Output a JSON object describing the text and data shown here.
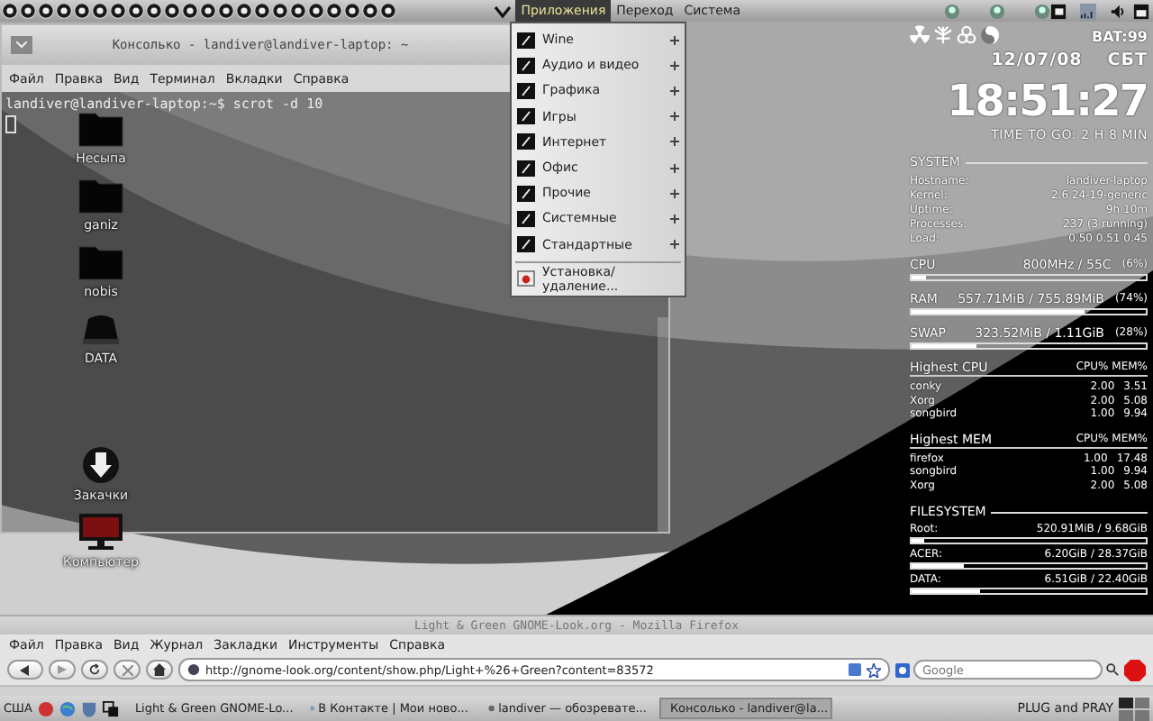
{
  "top_panel": {
    "menus": [
      {
        "label": "Приложения",
        "selected": true
      },
      {
        "label": "Переход",
        "selected": false
      },
      {
        "label": "Система",
        "selected": false
      }
    ]
  },
  "terminal": {
    "title": "Консолько - landiver@landiver-laptop: ~",
    "menu": [
      "Файл",
      "Правка",
      "Вид",
      "Терминал",
      "Вкладки",
      "Справка"
    ],
    "lines": [
      "landiver@landiver-laptop:~$ scrot -d 10"
    ]
  },
  "desktop_icons": [
    {
      "label": "Несыпа",
      "kind": "folder"
    },
    {
      "label": "ganiz",
      "kind": "folder"
    },
    {
      "label": "nobis",
      "kind": "folder"
    },
    {
      "label": "DATA",
      "kind": "drive"
    },
    {
      "label": "Закачки",
      "kind": "download"
    },
    {
      "label": "Компьютер",
      "kind": "computer"
    }
  ],
  "app_menu": {
    "items": [
      {
        "label": "Wine",
        "submenu": true
      },
      {
        "label": "Аудио и видео",
        "submenu": true
      },
      {
        "label": "Графика",
        "submenu": true
      },
      {
        "label": "Игры",
        "submenu": true
      },
      {
        "label": "Интернет",
        "submenu": true
      },
      {
        "label": "Офис",
        "submenu": true
      },
      {
        "label": "Прочие",
        "submenu": true
      },
      {
        "label": "Системные",
        "submenu": true
      },
      {
        "label": "Стандартные",
        "submenu": true
      },
      {
        "label": "Установка/удаление...",
        "submenu": false
      }
    ]
  },
  "conky": {
    "battery": "BAT:99",
    "date": "12/07/08",
    "weekday": "СБТ",
    "time": "18:51:27",
    "time_to_go": "TIME TO GO: 2 H 8 MIN",
    "system": {
      "title": "SYSTEM",
      "rows": [
        {
          "label": "Hostname:",
          "value": "landiver-laptop"
        },
        {
          "label": "Kernel:",
          "value": "2.6.24-19-generic"
        },
        {
          "label": "Uptime:",
          "value": "9h 10m"
        },
        {
          "label": "Processes:",
          "value": "237 (3 running)"
        },
        {
          "label": "Load:",
          "value": "0.50 0.51 0.45"
        }
      ]
    },
    "meters": [
      {
        "label": "CPU",
        "reading": "800MHz / 55C",
        "percent": "(6%)",
        "level": 0.06
      },
      {
        "label": "RAM",
        "reading": "557.71MiB / 755.89MiB",
        "percent": "(74%)",
        "level": 0.74
      },
      {
        "label": "SWAP",
        "reading": "323.52MiB / 1.11GiB",
        "percent": "(28%)",
        "level": 0.28
      }
    ],
    "top_lists": [
      {
        "title": "Highest CPU",
        "header": "CPU% MEM%",
        "rows": [
          {
            "name": "conky",
            "cpu": "2.00",
            "mem": "3.51"
          },
          {
            "name": "Xorg",
            "cpu": "2.00",
            "mem": "5.08"
          },
          {
            "name": "songbird",
            "cpu": "1.00",
            "mem": "9.94"
          }
        ]
      },
      {
        "title": "Highest MEM",
        "header": "CPU% MEM%",
        "rows": [
          {
            "name": "firefox",
            "cpu": "1.00",
            "mem": "17.48"
          },
          {
            "name": "songbird",
            "cpu": "1.00",
            "mem": "9.94"
          },
          {
            "name": "Xorg",
            "cpu": "2.00",
            "mem": "5.08"
          }
        ]
      }
    ],
    "filesystem": {
      "title": "FILESYSTEM",
      "disks": [
        {
          "label": "Root:",
          "reading": "520.91MiB / 9.68GiB",
          "level": 0.05
        },
        {
          "label": "ACER:",
          "reading": "6.20GiB / 28.37GiB",
          "level": 0.22
        },
        {
          "label": "DATA:",
          "reading": "6.51GiB / 22.40GiB",
          "level": 0.29
        }
      ]
    }
  },
  "firefox": {
    "title": "Light & Green GNOME-Look.org - Mozilla Firefox",
    "menu": [
      "Файл",
      "Правка",
      "Вид",
      "Журнал",
      "Закладки",
      "Инструменты",
      "Справка"
    ],
    "url": "http://gnome-look.org/content/show.php/Light+%26+Green?content=83572",
    "search": {
      "placeholder": "Google"
    }
  },
  "taskbar": {
    "keyboard": "США",
    "tasks": [
      {
        "label": "Light & Green GNOME-Lo...",
        "selected": false
      },
      {
        "label": "В Контакте | Мои ново...",
        "selected": false
      },
      {
        "label": "landiver — обозревате...",
        "selected": false
      },
      {
        "label": "Консолько - landiver@la...",
        "selected": true
      }
    ],
    "label": "PLUG and PRAY"
  }
}
